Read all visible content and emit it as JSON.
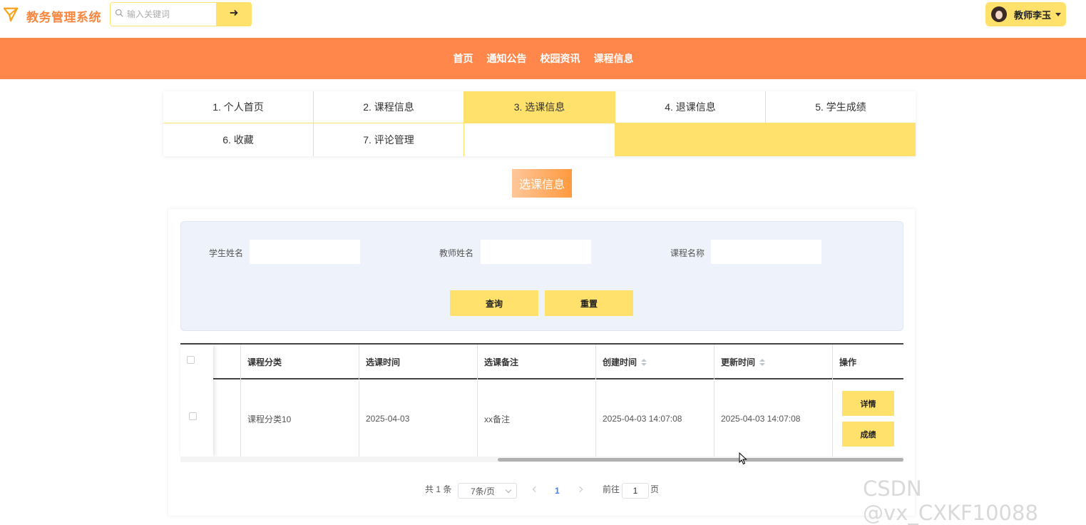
{
  "app": {
    "title": "教务管理系统"
  },
  "search": {
    "placeholder": "输入关键词"
  },
  "user": {
    "name": "教师李玉"
  },
  "nav": {
    "items": [
      "首页",
      "通知公告",
      "校园资讯",
      "课程信息"
    ]
  },
  "tabs": [
    "1. 个人首页",
    "2. 课程信息",
    "3. 选课信息",
    "4. 退课信息",
    "5. 学生成绩",
    "6. 收藏",
    "7. 评论管理"
  ],
  "active_tab": "3. 选课信息",
  "section_title": "选课信息",
  "filter": {
    "labels": [
      "学生姓名",
      "教师姓名",
      "课程名称"
    ],
    "values": [
      "",
      "",
      ""
    ],
    "query_label": "查询",
    "reset_label": "重置"
  },
  "table": {
    "headers": [
      "课程分类",
      "选课时间",
      "选课备注",
      "创建时间",
      "更新时间",
      "操作"
    ],
    "rows": [
      {
        "cells": [
          "课程分类10",
          "2025-04-03",
          "xx备注",
          "2025-04-03 14:07:08",
          "2025-04-03 14:07:08"
        ],
        "actions": [
          "详情",
          "成绩"
        ]
      }
    ]
  },
  "pagination": {
    "total": "共 1 条",
    "page_size": "7条/页",
    "current": "1",
    "goto_prefix": "前往",
    "goto_value": "1",
    "goto_suffix": "页"
  },
  "watermark": "CSDN @vx_CXKF10088",
  "colors": {
    "accent_yellow": "#ffe16b",
    "nav_orange": "#ff874c",
    "brand_orange": "#f7873f"
  },
  "icons": {
    "logo": "paper-plane-icon",
    "search": "search-icon",
    "submit": "arrow-right-icon"
  }
}
